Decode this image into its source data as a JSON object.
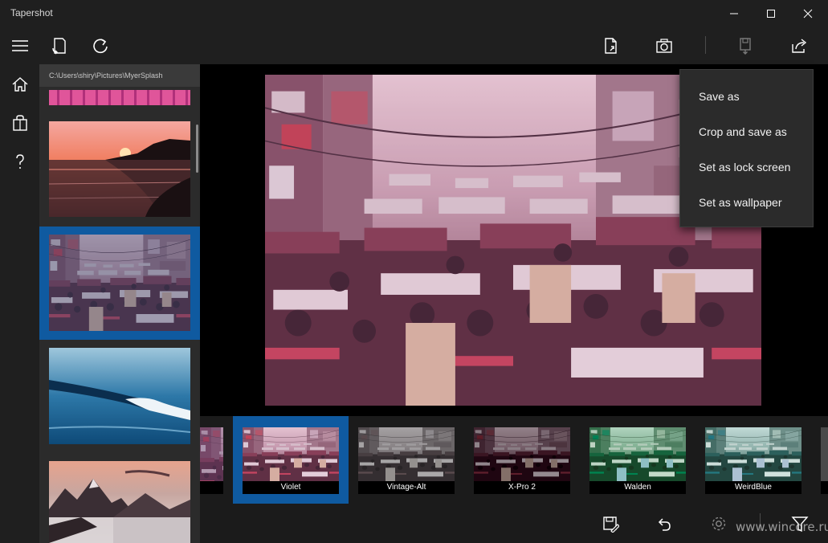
{
  "window": {
    "title": "Tapershot",
    "controls": [
      "minimize",
      "maximize",
      "close"
    ]
  },
  "toolbar": {
    "left_icons": [
      "rotate-file-icon",
      "refresh-icon"
    ],
    "right_icons": [
      "export-file-icon",
      "camera-icon",
      "save-disabled-icon",
      "share-icon"
    ]
  },
  "nav": {
    "items": [
      "menu-icon",
      "home-icon",
      "store-icon",
      "help-icon"
    ]
  },
  "files": {
    "path": "C:\\Users\\shiry\\Pictures\\MyerSplash",
    "items": [
      "sunset-sea",
      "street-traffic",
      "ocean-wave",
      "mountains"
    ],
    "selected_index": 1
  },
  "flyout": {
    "items": [
      "Save as",
      "Crop and save as",
      "Set as lock screen",
      "Set as wallpaper"
    ]
  },
  "filters": {
    "selected": "Violet",
    "items": [
      "Violet",
      "Vintage-Alt",
      "X-Pro 2",
      "Walden",
      "WeirdBlue"
    ]
  },
  "bottombar": {
    "icons": [
      "save-icon",
      "undo-icon",
      "settings-icon",
      "filter-icon"
    ],
    "watermark": "www.wincore.ru"
  },
  "colors": {
    "accent": "#0f5aa0",
    "chrome": "#1f1f1f",
    "pane": "#2b2b2b"
  }
}
